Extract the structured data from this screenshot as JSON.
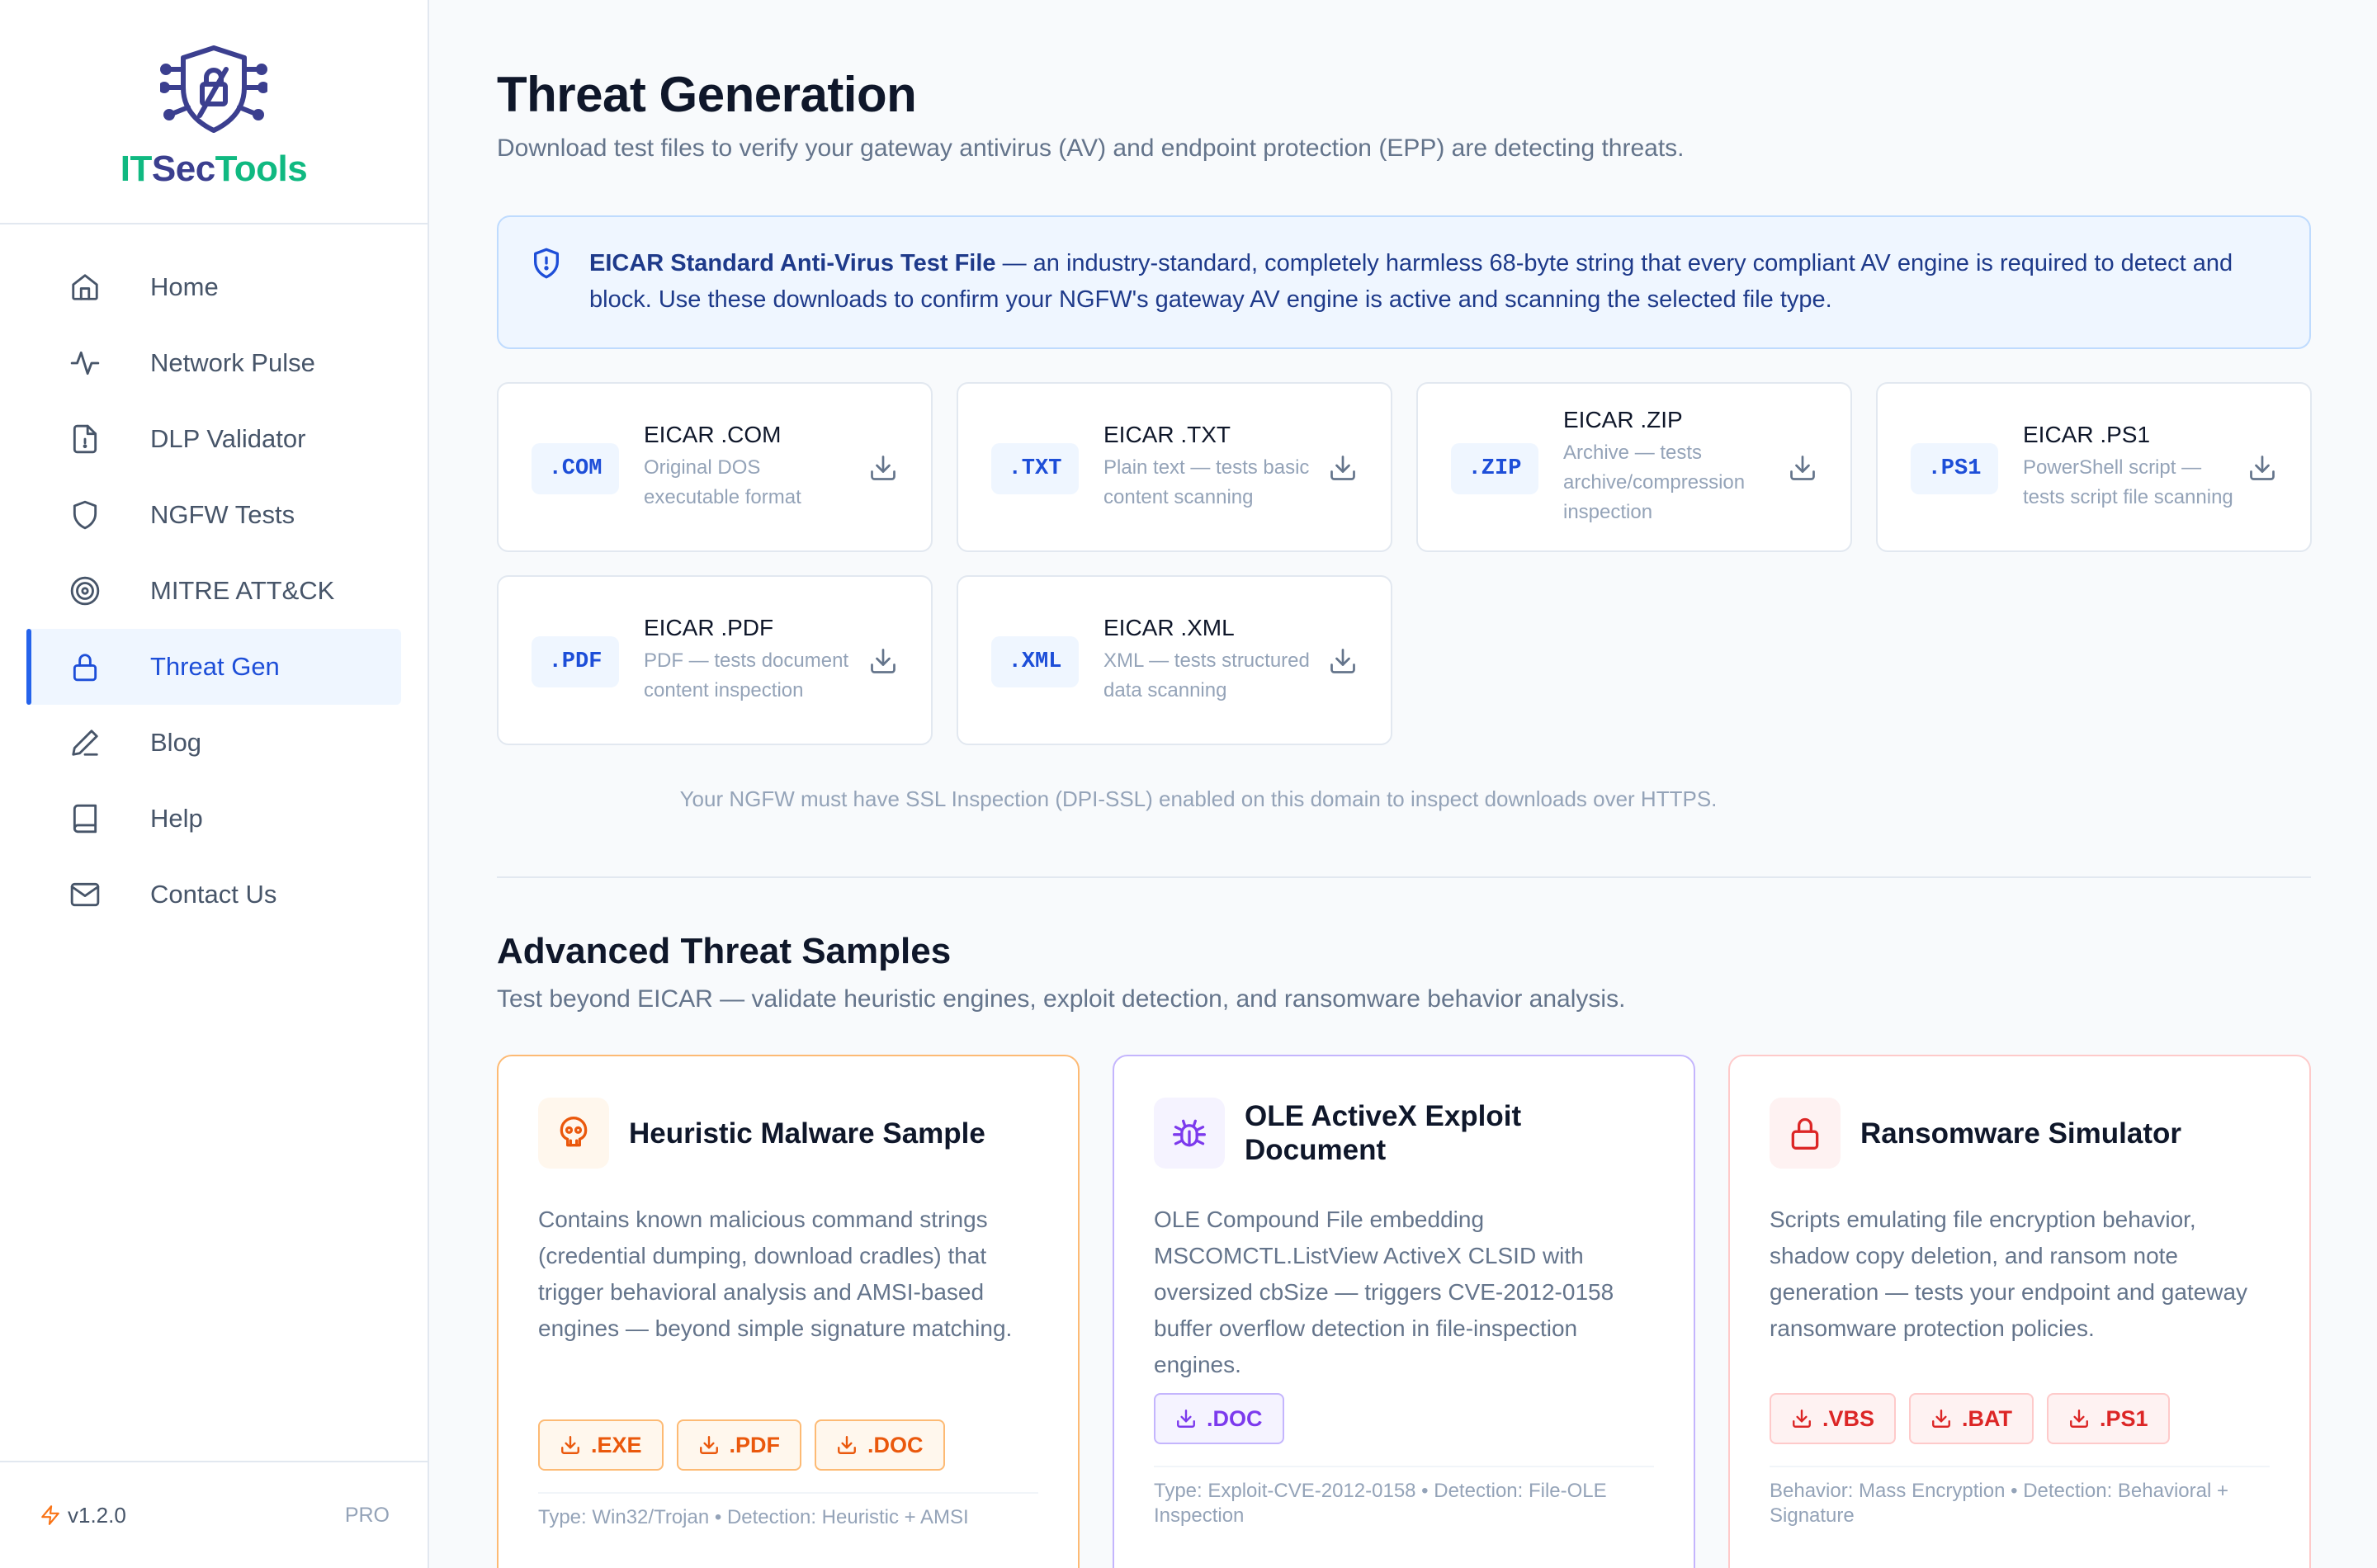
{
  "brand": {
    "name_part1": "IT",
    "name_part2": "Sec",
    "name_part3": "Tools"
  },
  "sidebar": {
    "items": [
      {
        "label": "Home",
        "icon": "home-icon"
      },
      {
        "label": "Network Pulse",
        "icon": "activity-icon"
      },
      {
        "label": "DLP Validator",
        "icon": "file-icon"
      },
      {
        "label": "NGFW Tests",
        "icon": "shield-icon"
      },
      {
        "label": "MITRE ATT&CK",
        "icon": "target-icon"
      },
      {
        "label": "Threat Gen",
        "icon": "lock-icon",
        "active": true
      },
      {
        "label": "Blog",
        "icon": "pen-icon"
      },
      {
        "label": "Help",
        "icon": "book-icon"
      },
      {
        "label": "Contact Us",
        "icon": "mail-icon"
      }
    ],
    "version": "v1.2.0",
    "tier": "PRO"
  },
  "page": {
    "title": "Threat Generation",
    "subtitle": "Download test files to verify your gateway antivirus (AV) and endpoint protection (EPP) are detecting threats."
  },
  "info": {
    "bold": "EICAR Standard Anti-Virus Test File",
    "text": " — an industry-standard, completely harmless 68-byte string that every compliant AV engine is required to detect and block. Use these downloads to confirm your NGFW's gateway AV engine is active and scanning the selected file type."
  },
  "eicar_files": [
    {
      "badge": ".COM",
      "title": "EICAR .COM",
      "desc": "Original DOS executable format"
    },
    {
      "badge": ".TXT",
      "title": "EICAR .TXT",
      "desc": "Plain text — tests basic content scanning"
    },
    {
      "badge": ".ZIP",
      "title": "EICAR .ZIP",
      "desc": "Archive — tests archive/compression inspection"
    },
    {
      "badge": ".PS1",
      "title": "EICAR .PS1",
      "desc": "PowerShell script — tests script file scanning"
    },
    {
      "badge": ".PDF",
      "title": "EICAR .PDF",
      "desc": "PDF — tests document content inspection"
    },
    {
      "badge": ".XML",
      "title": "EICAR .XML",
      "desc": "XML — tests structured data scanning"
    }
  ],
  "ssl_note": "Your NGFW must have SSL Inspection (DPI-SSL) enabled on this domain to inspect downloads over HTTPS.",
  "advanced": {
    "title": "Advanced Threat Samples",
    "subtitle": "Test beyond EICAR — validate heuristic engines, exploit detection, and ransomware behavior analysis.",
    "cards": [
      {
        "title": "Heuristic Malware Sample",
        "desc": "Contains known malicious command strings (credential dumping, download cradles) that trigger behavioral analysis and AMSI-based engines — beyond simple signature matching.",
        "buttons": [
          ".EXE",
          ".PDF",
          ".DOC"
        ],
        "meta": "Type: Win32/Trojan • Detection: Heuristic + AMSI",
        "icon": "skull-icon",
        "accent": "#ea580c"
      },
      {
        "title": "OLE ActiveX Exploit Document",
        "desc": "OLE Compound File embedding MSCOMCTL.ListView ActiveX CLSID with oversized cbSize — triggers CVE-2012-0158 buffer overflow detection in file-inspection engines.",
        "buttons": [
          ".DOC"
        ],
        "meta": "Type: Exploit-CVE-2012-0158 • Detection: File-OLE Inspection",
        "icon": "bug-icon",
        "accent": "#7c3aed"
      },
      {
        "title": "Ransomware Simulator",
        "desc": "Scripts emulating file encryption behavior, shadow copy deletion, and ransom note generation — tests your endpoint and gateway ransomware protection policies.",
        "buttons": [
          ".VBS",
          ".BAT",
          ".PS1"
        ],
        "meta": "Behavior: Mass Encryption • Detection: Behavioral + Signature",
        "icon": "lock-icon",
        "accent": "#dc2626"
      }
    ]
  }
}
